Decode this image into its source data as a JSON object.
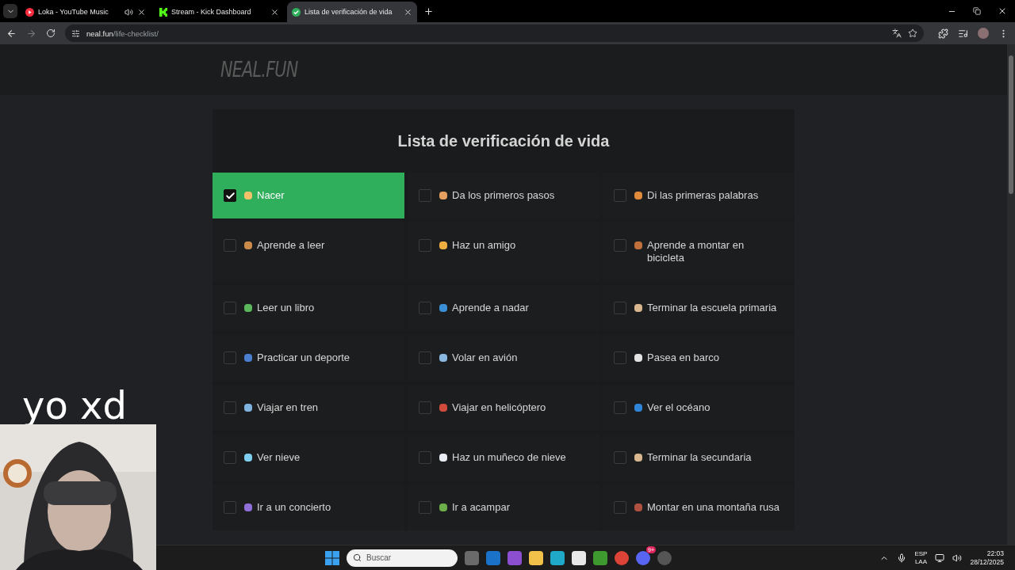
{
  "browser": {
    "tabs": [
      {
        "title": "Loka - YouTube Music",
        "selected": false,
        "audio": true,
        "kind": "youtube"
      },
      {
        "title": "Stream - Kick Dashboard",
        "selected": false,
        "audio": false,
        "kind": "kick"
      },
      {
        "title": "Lista de verificación de vida",
        "selected": true,
        "audio": false,
        "kind": "check"
      }
    ],
    "address": {
      "domain": "neal.fun",
      "path": "/life-checklist/"
    }
  },
  "page": {
    "logo": "NEAL.FUN",
    "title": "Lista de verificación de vida",
    "items": [
      {
        "label": "Nacer",
        "checked": true
      },
      {
        "label": "Da los primeros pasos",
        "checked": false
      },
      {
        "label": "Di las primeras palabras",
        "checked": false
      },
      {
        "label": "Aprende a leer",
        "checked": false
      },
      {
        "label": "Haz un amigo",
        "checked": false
      },
      {
        "label": "Aprende a montar en bicicleta",
        "checked": false
      },
      {
        "label": "Leer un libro",
        "checked": false
      },
      {
        "label": "Aprende a nadar",
        "checked": false
      },
      {
        "label": "Terminar la escuela primaria",
        "checked": false
      },
      {
        "label": "Practicar un deporte",
        "checked": false
      },
      {
        "label": "Volar en avión",
        "checked": false
      },
      {
        "label": "Pasea en barco",
        "checked": false
      },
      {
        "label": "Viajar en tren",
        "checked": false
      },
      {
        "label": "Viajar en helicóptero",
        "checked": false
      },
      {
        "label": "Ver el océano",
        "checked": false
      },
      {
        "label": "Ver nieve",
        "checked": false
      },
      {
        "label": "Haz un muñeco de nieve",
        "checked": false
      },
      {
        "label": "Terminar la secundaria",
        "checked": false
      },
      {
        "label": "Ir a un concierto",
        "checked": false
      },
      {
        "label": "Ir a acampar",
        "checked": false
      },
      {
        "label": "Montar en una montaña rusa",
        "checked": false
      }
    ]
  },
  "overlay": {
    "caption": "yo xd"
  },
  "taskbar": {
    "search_placeholder": "Buscar",
    "discord_badge": "9+",
    "language": "ESP",
    "region": "LAA",
    "time": "22:03",
    "date": "28/12/2025"
  }
}
